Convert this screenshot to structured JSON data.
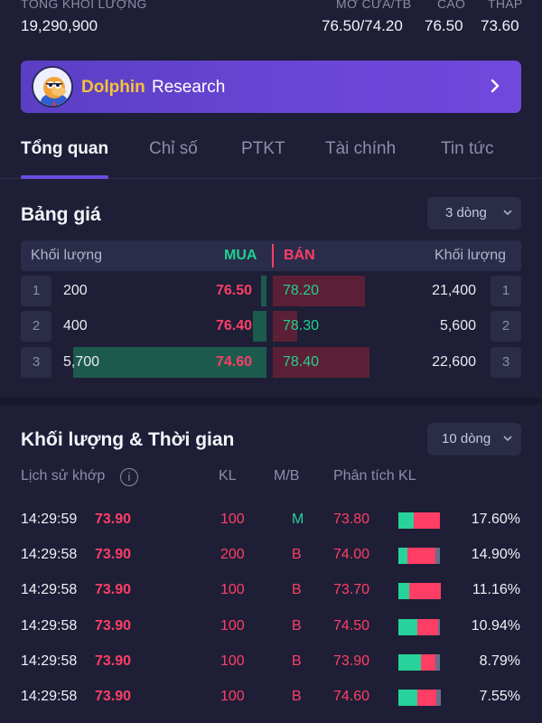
{
  "stats": {
    "total_volume_label": "TỔNG KHỐI LƯỢNG",
    "total_volume": "19,290,900",
    "open_avg_label": "MỞ CỬA/TB",
    "open_avg": "76.50/74.20",
    "high_label": "CAO",
    "high": "76.50",
    "low_label": "THẤP",
    "low": "73.60"
  },
  "banner": {
    "brand_part1": "Dolphin",
    "brand_part2": "Research",
    "icon": "chevron-right-icon"
  },
  "tabs": [
    "Tổng quan",
    "Chỉ số",
    "PTKT",
    "Tài chính",
    "Tin tức"
  ],
  "active_tab": "Tổng quan",
  "order_book": {
    "title": "Bảng giá",
    "rows_select": "3 dòng",
    "headers": {
      "buy_volume": "Khối lượng",
      "buy": "MUA",
      "sell": "BÁN",
      "sell_volume": "Khối lượng"
    },
    "rows": [
      {
        "index": "1",
        "buy_volume": "200",
        "buy_price": "76.50",
        "sell_price": "78.20",
        "sell_volume": "21,400",
        "sell_index": "1",
        "buy_share": 0.03,
        "sell_share": 0.76
      },
      {
        "index": "2",
        "buy_volume": "400",
        "buy_price": "76.40",
        "sell_price": "78.30",
        "sell_volume": "5,600",
        "sell_index": "2",
        "buy_share": 0.07,
        "sell_share": 0.2
      },
      {
        "index": "3",
        "buy_volume": "5,700",
        "buy_price": "74.60",
        "sell_price": "78.40",
        "sell_volume": "22,600",
        "sell_index": "3",
        "buy_share": 1.0,
        "sell_share": 0.8
      }
    ]
  },
  "trades": {
    "title": "Khối lượng & Thời gian",
    "rows_select": "10 dòng",
    "headers": {
      "history": "Lịch sử khớp",
      "kl": "KL",
      "mb": "M/B",
      "analysis": "Phân tích KL"
    },
    "colors": {
      "buy": "#27d39a",
      "sell": "#ff3e66"
    },
    "rows": [
      {
        "time": "14:29:59",
        "price": "73.90",
        "kl": "100",
        "mb": "M",
        "analysis_price": "73.80",
        "pct": "17.60%",
        "buy_part": 0.38,
        "sell_part": 0.62,
        "idle_part": 0.0
      },
      {
        "time": "14:29:58",
        "price": "73.90",
        "kl": "200",
        "mb": "B",
        "analysis_price": "74.00",
        "pct": "14.90%",
        "buy_part": 0.22,
        "sell_part": 0.68,
        "idle_part": 0.1
      },
      {
        "time": "14:29:58",
        "price": "73.90",
        "kl": "100",
        "mb": "B",
        "analysis_price": "73.70",
        "pct": "11.16%",
        "buy_part": 0.25,
        "sell_part": 0.75,
        "idle_part": 0.0
      },
      {
        "time": "14:29:58",
        "price": "73.90",
        "kl": "100",
        "mb": "B",
        "analysis_price": "74.50",
        "pct": "10.94%",
        "buy_part": 0.45,
        "sell_part": 0.5,
        "idle_part": 0.05
      },
      {
        "time": "14:29:58",
        "price": "73.90",
        "kl": "100",
        "mb": "B",
        "analysis_price": "73.90",
        "pct": "8.79%",
        "buy_part": 0.55,
        "sell_part": 0.35,
        "idle_part": 0.1
      },
      {
        "time": "14:29:58",
        "price": "73.90",
        "kl": "100",
        "mb": "B",
        "analysis_price": "74.60",
        "pct": "7.55%",
        "buy_part": 0.45,
        "sell_part": 0.45,
        "idle_part": 0.1
      }
    ]
  }
}
